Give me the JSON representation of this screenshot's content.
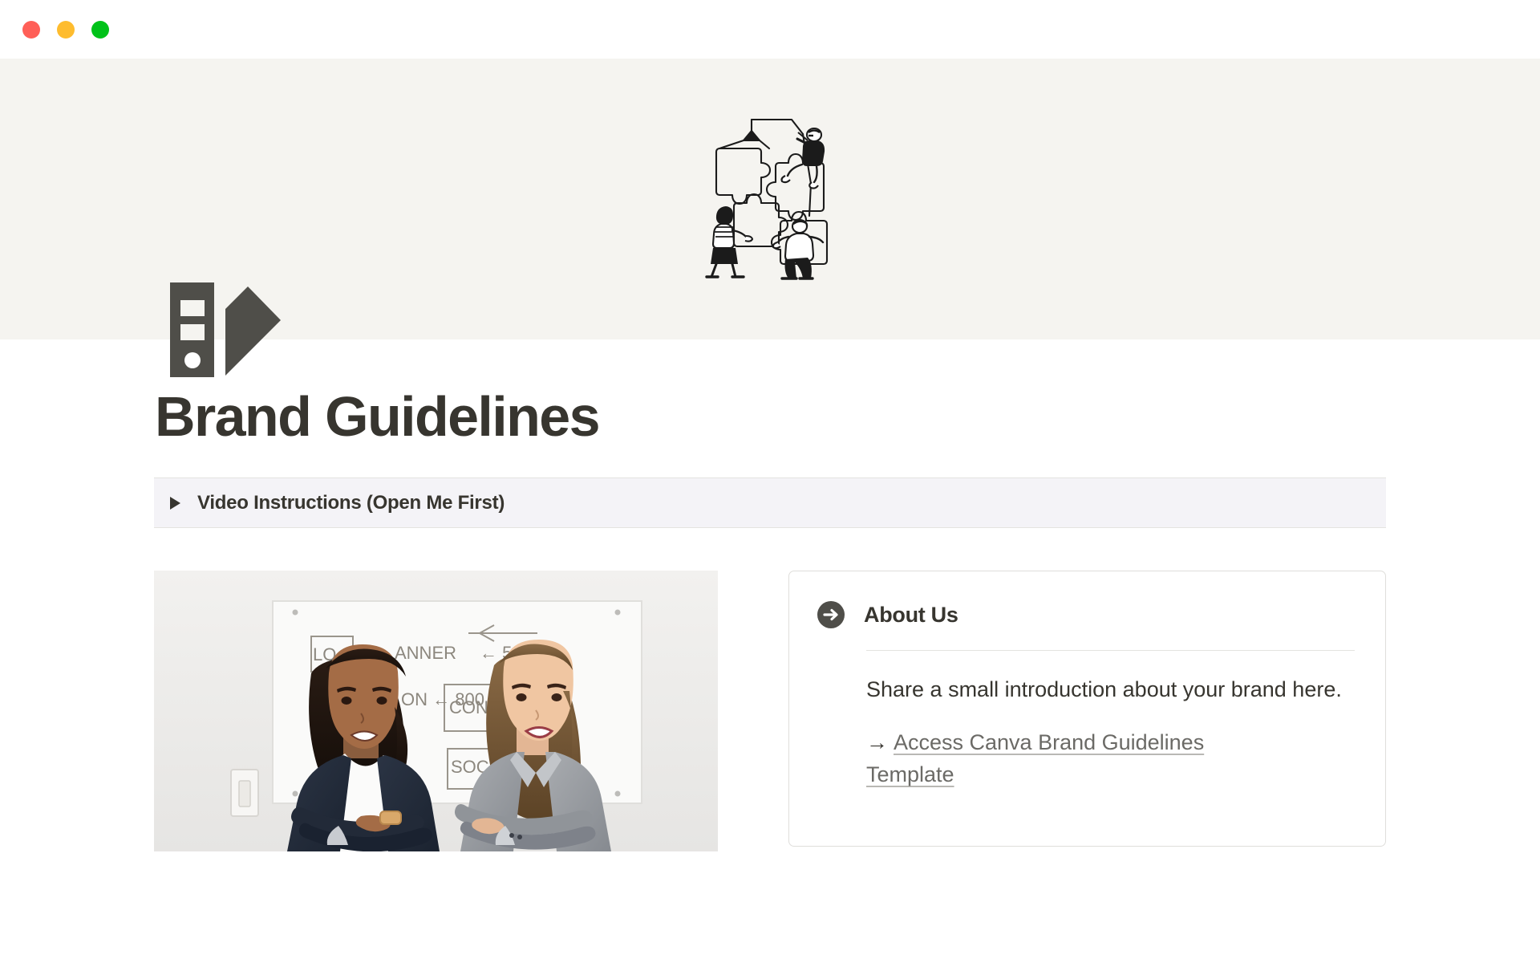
{
  "window": {
    "traffic_lights": [
      {
        "name": "close",
        "color": "#FF5F57"
      },
      {
        "name": "minimize",
        "color": "#FEBC2E"
      },
      {
        "name": "maximize",
        "color": "#00C219"
      }
    ]
  },
  "cover": {
    "background_color": "#F5F4F0",
    "illustration_name": "people-assembling-puzzle-illustration",
    "illustration_description": "Line drawing of four people lifting and fitting together four large jigsaw puzzle pieces with a crane hook and rope"
  },
  "page": {
    "icon_name": "binder-flag-icon",
    "icon_color": "#4F4E49",
    "title": "Brand Guidelines",
    "title_color": "#37352F"
  },
  "toggle": {
    "caret_name": "collapsed-triangle-icon",
    "label": "Video Instructions (Open Me First)",
    "background_color": "#F4F3F7",
    "expanded": false
  },
  "photo": {
    "name": "team-photo",
    "alt": "Two smiling businesswomen standing with arms crossed in front of a whiteboard",
    "whiteboard_text": [
      "LO",
      "BANNER ← 500",
      "ON ← 800 px",
      "CONTENT",
      "SOCIAL"
    ]
  },
  "about_card": {
    "icon_name": "arrow-right-circle-icon",
    "title": "About Us",
    "body": "Share a small introduction about your brand here.",
    "link_arrow": "→",
    "link_text": "Access Canva Brand Guidelines Template",
    "border_color": "#DFDEDB"
  }
}
